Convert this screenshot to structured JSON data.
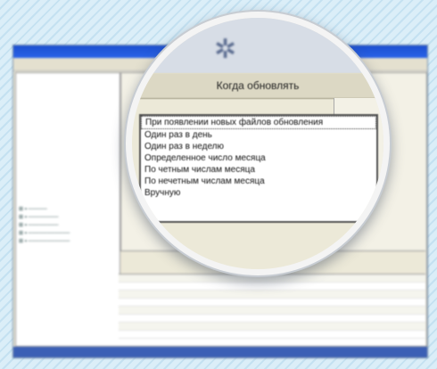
{
  "dialog": {
    "title": "Когда обновлять",
    "options": [
      "При появлении новых файлов обновления",
      "Один раз в день",
      "Один раз в неделю",
      "Определенное число месяца",
      "По четным числам месяца",
      "По нечетным числам месяца",
      "Вручную"
    ],
    "selected_index": 0
  }
}
